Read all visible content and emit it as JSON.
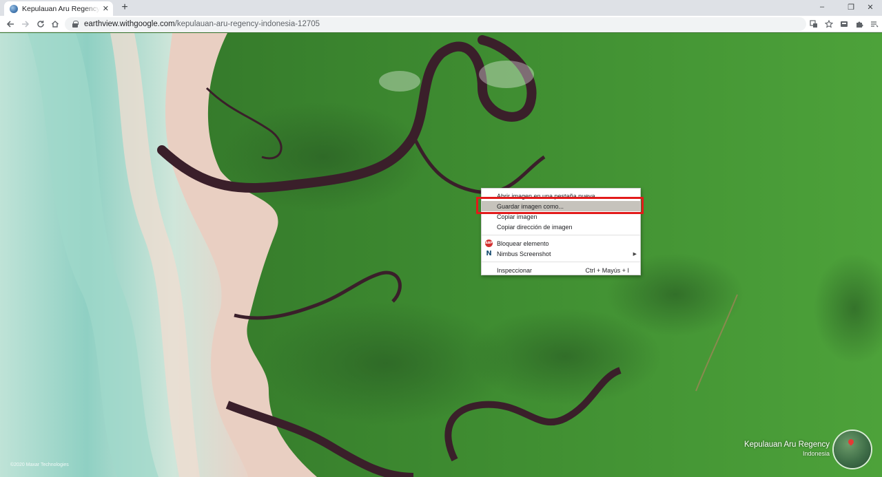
{
  "browser": {
    "tab_title": "Kepulauan Aru Regency, Indonesia",
    "tab_close": "✕",
    "new_tab": "+",
    "url_domain": "earthview.withgoogle.com",
    "url_path": "/kepulauan-aru-regency-indonesia-12705",
    "icons": [
      "translate-icon",
      "star-icon",
      "extension-icon",
      "puzzle-icon",
      "reading-list-icon",
      "profile-avatar",
      "menu-icon"
    ]
  },
  "window_controls": {
    "minimize": "–",
    "maximize": "❐",
    "close": "✕"
  },
  "page": {
    "location": "Kepulauan Aru Regency",
    "country": "Indonesia",
    "copyright": "©2020 Maxar Technologies"
  },
  "context_menu": {
    "items": [
      {
        "label": "Abrir imagen en una pestaña nueva"
      },
      {
        "label": "Guardar imagen como...",
        "highlighted": true
      },
      {
        "label": "Copiar imagen"
      },
      {
        "label": "Copiar dirección de imagen"
      },
      {
        "label": "Bloquear elemento",
        "icon": "adblock-icon",
        "icon_text": "ABP"
      },
      {
        "label": "Nimbus Screenshot",
        "icon": "nimbus-icon",
        "icon_text": "N",
        "submenu": true
      },
      {
        "label": "Inspeccionar",
        "shortcut": "Ctrl + Mayús + I"
      }
    ],
    "highlight_color": "#e21a1a"
  },
  "colors": {
    "forest": "#3f8a33",
    "river": "#3a1f2a",
    "water": "#8fd0c3",
    "sand": "#e9cfc2"
  }
}
